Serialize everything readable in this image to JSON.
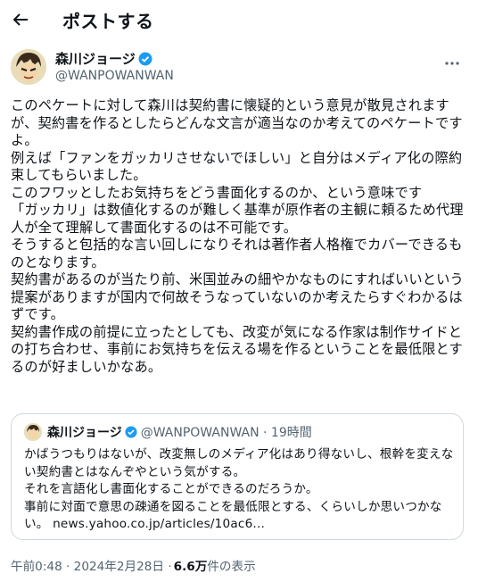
{
  "header": {
    "title": "ポストする"
  },
  "author": {
    "name": "森川ジョージ",
    "handle": "@WANPOWANWAN"
  },
  "icons": [
    "back-arrow-icon",
    "verified-badge-icon",
    "more-icon"
  ],
  "post": {
    "paragraphs": [
      "このペケートに対して森川は契約書に懐疑的という意見が散見されますが、契約書を作るとしたらどんな文言が適当なのか考えてのペケートですよ。",
      "例えば「ファンをガッカリさせないでほしい」と自分はメディア化の際約束してもらいました。",
      "このフワッとしたお気持ちをどう書面化するのか、という意味です",
      "「ガッカリ」は数値化するのが難しく基準が原作者の主観に頼るため代理人が全て理解して書面化するのは不可能です。",
      "そうすると包括的な言い回しになりそれは著作者人格権でカバーできるものとなります。",
      "契約書があるのが当たり前、米国並みの細やかなものにすればいいという提案がありますが国内で何故そうなっていないのか考えたらすぐわかるはずです。",
      "契約書作成の前提に立ったとしても、改変が気になる作家は制作サイドとの打ち合わせ、事前にお気持ちを伝える場を作るということを最低限とするのが好ましいかなあ。"
    ]
  },
  "quote": {
    "name": "森川ジョージ",
    "handle_time": "@WANPOWANWAN · 19時間",
    "paragraphs": [
      "かばうつもりはないが、改変無しのメディア化はあり得ないし、根幹を変えない契約書とはなんぞやという気がする。",
      "それを言語化し書面化することができるのだろうか。",
      "事前に対面で意思の疎通を図ることを最低限とする、くらいしか思いつかない。 news.yahoo.co.jp/articles/10ac6..."
    ]
  },
  "meta": {
    "datetime": "午前0:48 · 2024年2月28日 · ",
    "views": "6.6万",
    "views_suffix": " 件の表示"
  }
}
